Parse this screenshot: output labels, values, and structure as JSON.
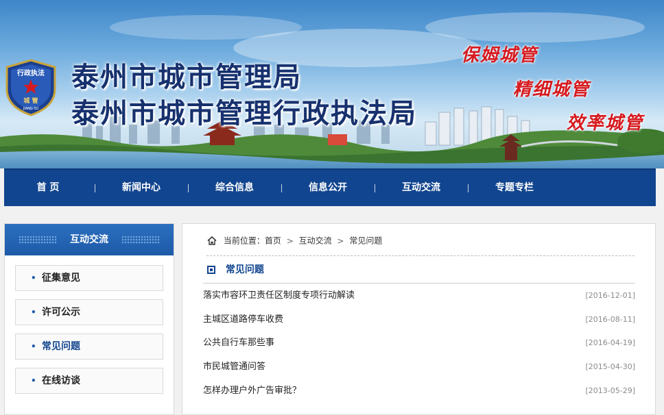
{
  "banner": {
    "title_line1": "泰州市城市管理局",
    "title_line2": "泰州市城市管理行政执法局",
    "slogans": [
      "保姆城管",
      "精细城管",
      "效率城管"
    ],
    "logo": {
      "top_text": "行政执法",
      "middle_text": "城 管",
      "bottom_text": "JIANG SU"
    }
  },
  "nav": {
    "items": [
      "首  页",
      "新闻中心",
      "综合信息",
      "信息公开",
      "互动交流",
      "专题专栏"
    ]
  },
  "sidebar": {
    "header": "互动交流",
    "items": [
      "征集意见",
      "许可公示",
      "常见问题",
      "在线访谈"
    ],
    "active": "常见问题"
  },
  "breadcrumb": {
    "label": "当前位置：",
    "items": [
      "首页",
      "互动交流",
      "常见问题"
    ]
  },
  "section": {
    "title": "常见问题",
    "articles": [
      {
        "title": "落实市容环卫责任区制度专项行动解读",
        "date": "[2016-12-01]"
      },
      {
        "title": "主城区道路停车收费",
        "date": "[2016-08-11]"
      },
      {
        "title": "公共自行车那些事",
        "date": "[2016-04-19]"
      },
      {
        "title": "市民城管通问答",
        "date": "[2015-04-30]"
      },
      {
        "title": "怎样办理户外广告审批？",
        "date": "[2013-05-29]"
      }
    ]
  },
  "colors": {
    "primary": "#12458f",
    "slogan_red": "#d61a1f",
    "title_blue": "#17316e"
  }
}
